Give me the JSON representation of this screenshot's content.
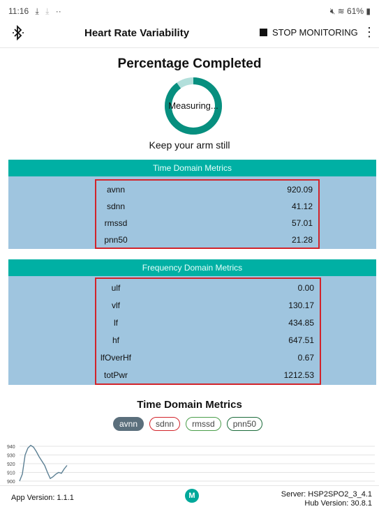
{
  "status_bar": {
    "time": "11:16",
    "left_icons": [
      "download-icon",
      "download-icon",
      "more-notifications-icon"
    ],
    "right_text": "61%",
    "right_icons": [
      "mute-icon",
      "wifi-icon",
      "battery-icon"
    ]
  },
  "app_bar": {
    "bluetooth_icon": "bluetooth-icon",
    "title": "Heart Rate Variability",
    "stop_label": "STOP MONITORING",
    "more_icon": "more-vert-icon"
  },
  "progress": {
    "title": "Percentage Completed",
    "status": "Measuring...",
    "fraction": 0.9,
    "ring_color": "#078f7f",
    "track_color": "#b2dfdb",
    "instruction": "Keep your arm still"
  },
  "time_domain_metrics": {
    "header": "Time Domain Metrics",
    "rows": [
      {
        "name": "avnn",
        "value": "920.09"
      },
      {
        "name": "sdnn",
        "value": "41.12"
      },
      {
        "name": "rmssd",
        "value": "57.01"
      },
      {
        "name": "pnn50",
        "value": "21.28"
      }
    ]
  },
  "frequency_domain_metrics": {
    "header": "Frequency Domain Metrics",
    "rows": [
      {
        "name": "ulf",
        "value": "0.00"
      },
      {
        "name": "vlf",
        "value": "130.17"
      },
      {
        "name": "lf",
        "value": "434.85"
      },
      {
        "name": "hf",
        "value": "647.51"
      },
      {
        "name": "lfOverHf",
        "value": "0.67"
      },
      {
        "name": "totPwr",
        "value": "1212.53"
      }
    ]
  },
  "chart_section": {
    "title": "Time Domain Metrics",
    "chips": [
      "avnn",
      "sdnn",
      "rmssd",
      "pnn50"
    ],
    "selected": "avnn"
  },
  "chart_data": {
    "type": "line",
    "ylim": [
      900,
      940
    ],
    "yticks": [
      "940",
      "930",
      "920",
      "910",
      "900"
    ],
    "x": [
      0,
      1,
      2,
      3,
      4,
      5,
      6,
      7,
      8,
      9,
      10,
      11,
      12,
      13,
      14,
      15,
      16,
      17
    ],
    "series": [
      {
        "values": [
          900,
          908,
          930,
          938,
          941,
          939,
          934,
          928,
          923,
          918,
          910,
          903,
          905,
          908,
          910,
          909,
          914,
          918
        ]
      }
    ],
    "line_color": "#5b7f93",
    "grid": true
  },
  "footer": {
    "app_version": "App Version: 1.1.1",
    "logo_text": "M",
    "server": "Server: HSP2SPO2_3_4.1",
    "hub": "Hub Version: 30.8.1"
  }
}
